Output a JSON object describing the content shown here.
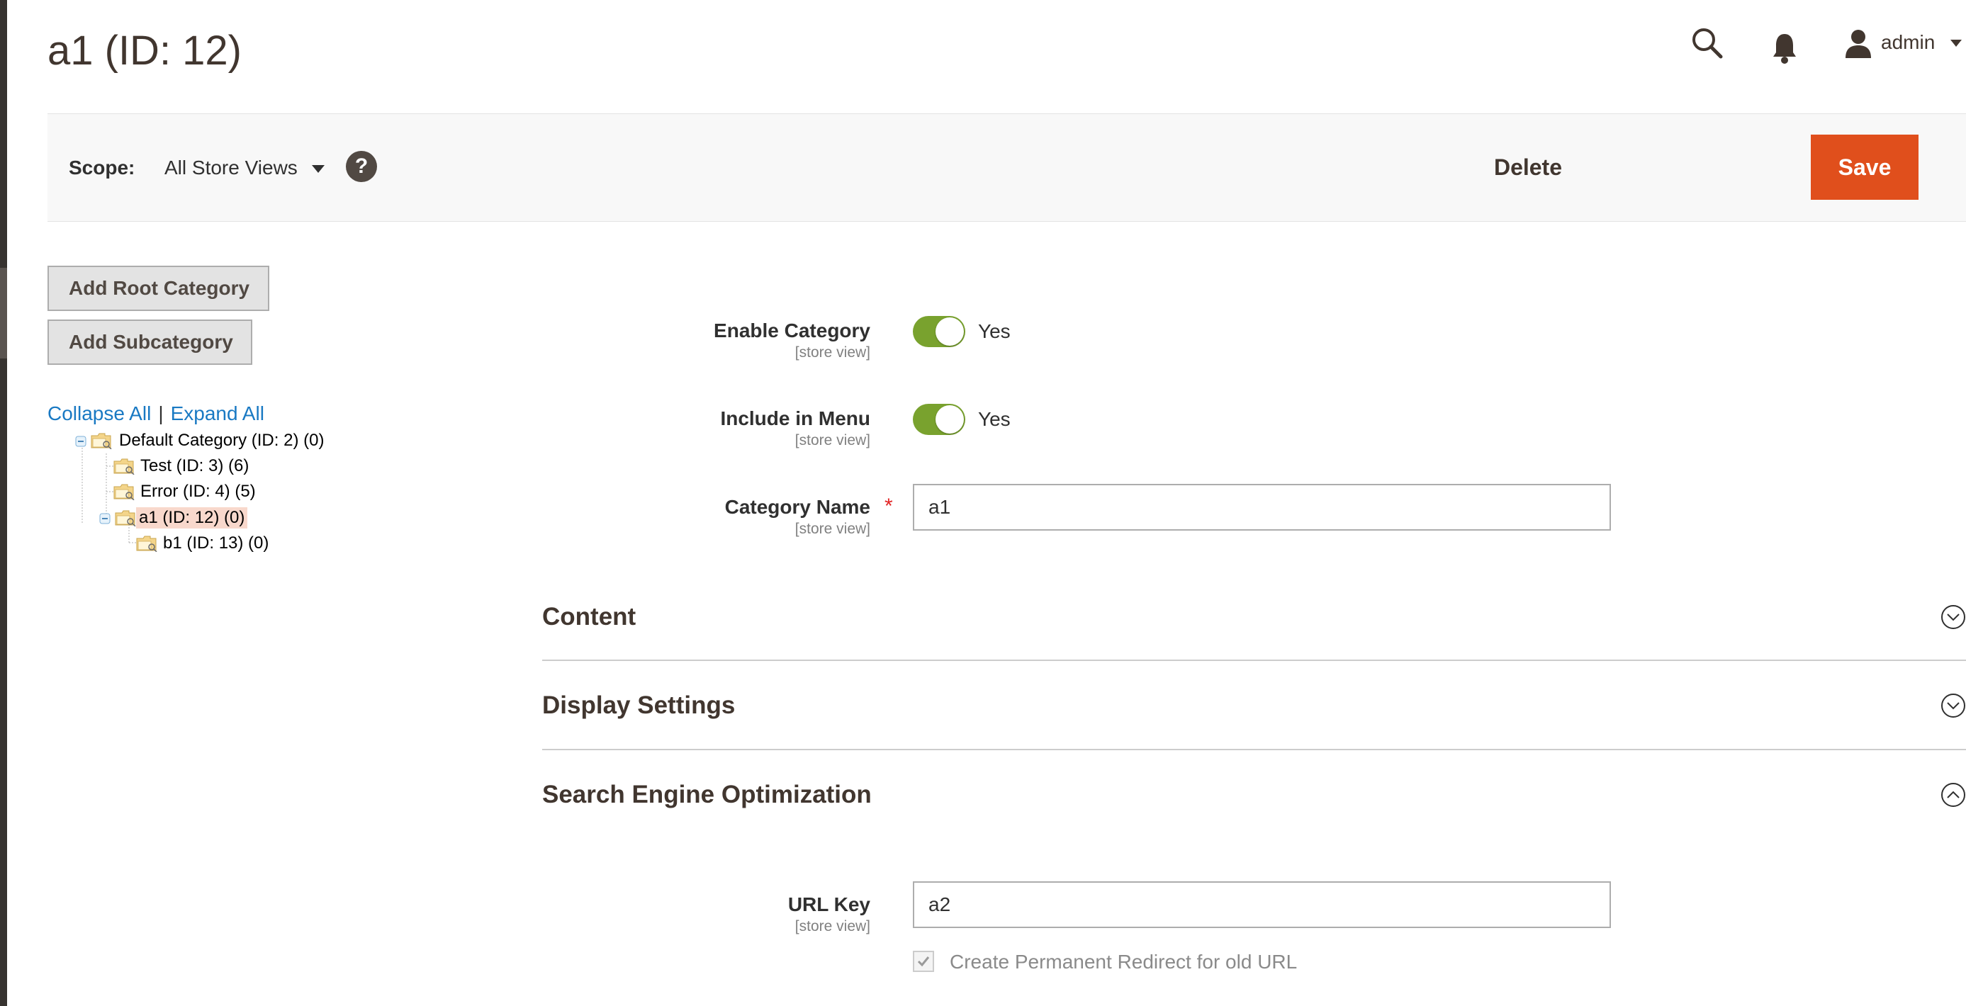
{
  "page": {
    "title": "a1 (ID: 12)"
  },
  "header": {
    "user_name": "admin"
  },
  "toolbar": {
    "scope_label": "Scope:",
    "scope_value": "All Store Views",
    "help_label": "?",
    "delete_label": "Delete",
    "save_label": "Save",
    "accent_color": "#e04f1c"
  },
  "sidebar": {
    "add_root_label": "Add Root Category",
    "add_sub_label": "Add Subcategory",
    "collapse_all": "Collapse All",
    "separator": "|",
    "expand_all": "Expand All",
    "tree": [
      {
        "label": "Default Category (ID: 2) (0)",
        "expanded": true
      },
      {
        "label": "Test (ID: 3) (6)"
      },
      {
        "label": "Error (ID: 4) (5)"
      },
      {
        "label": "a1 (ID: 12) (0)",
        "expanded": true,
        "selected": true
      },
      {
        "label": "b1 (ID: 13) (0)"
      }
    ]
  },
  "form": {
    "enable_category": {
      "label": "Enable Category",
      "scope": "[store view]",
      "value": "Yes",
      "on": true
    },
    "include_in_menu": {
      "label": "Include in Menu",
      "scope": "[store view]",
      "value": "Yes",
      "on": true
    },
    "category_name": {
      "label": "Category Name",
      "scope": "[store view]",
      "required": "*",
      "value": "a1"
    }
  },
  "sections": {
    "content": {
      "title": "Content",
      "expanded": false
    },
    "display_settings": {
      "title": "Display Settings",
      "expanded": false
    },
    "seo": {
      "title": "Search Engine Optimization",
      "expanded": true
    }
  },
  "seo": {
    "url_key": {
      "label": "URL Key",
      "scope": "[store view]",
      "value": "a2"
    },
    "redirect_checkbox": {
      "label": "Create Permanent Redirect for old URL",
      "checked": true
    }
  },
  "colors": {
    "switch_on": "#79a22e",
    "link": "#1979c3",
    "selected_node": "#f8d8cc"
  }
}
